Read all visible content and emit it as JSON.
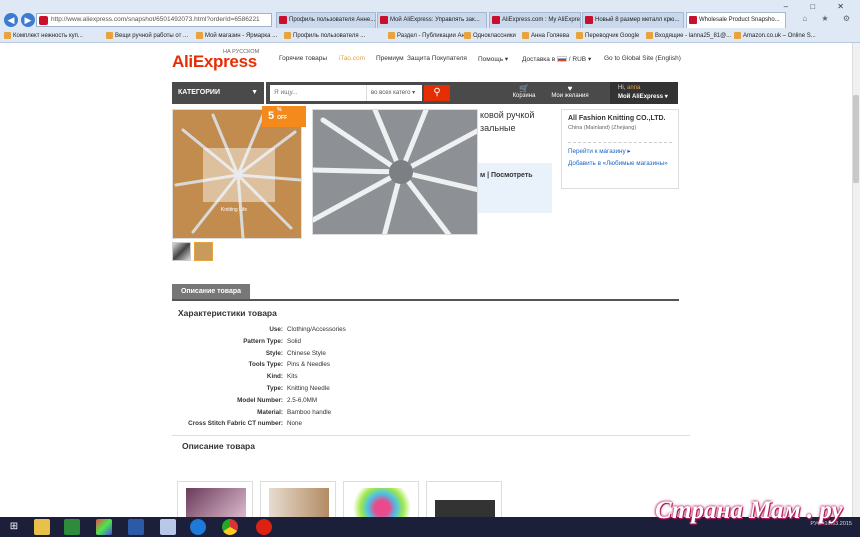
{
  "browser": {
    "address": "http://www.aliexpress.com/snapshot/6501492073.html?orderId=6586221",
    "tabs": [
      {
        "label": "Профиль пользователя Анне...",
        "active": false,
        "icon": "ali"
      },
      {
        "label": "Мой AliExpress: Управлять зак...",
        "active": false,
        "icon": "ali"
      },
      {
        "label": "AliExpress.com : My AliExpress",
        "active": false,
        "icon": "ali"
      },
      {
        "label": "Новый 8 размер металл крю...",
        "active": false,
        "icon": "ali"
      },
      {
        "label": "Wholesale Product Snapsho...",
        "active": true,
        "icon": "ali"
      }
    ],
    "bookmarks": [
      "Комплект нежность куп...",
      "Вещи ручной работы от ...",
      "Мой магазин - Ярмарка ...",
      "Профиль пользователя ...",
      "Раздел - Публикации Ан...",
      "Одноклассники",
      "Анна Голяева",
      "Переводчик Google",
      "Входящие - lanna25_81@...",
      "Amazon.co.uk – Online S..."
    ]
  },
  "site": {
    "logo": "AliExpress",
    "logo_sub": "НА РУССКОМ",
    "nav": {
      "hot": "Горячие товары",
      "itao": "iTao.com",
      "premium": "Премиум",
      "protection": "Защита Покупателя",
      "help": "Помощь",
      "delivery": "Доставка в",
      "currency": "RUB",
      "global": "Go to Global Site (English)"
    },
    "categories": "КАТЕГОРИИ",
    "search": {
      "placeholder": "Я ищу...",
      "category": "во всех катего"
    },
    "cart": "Корзина",
    "wishlist": "Мои желания",
    "account": {
      "greeting": "Hi,",
      "name": "anna",
      "label": "Мой AliExpress"
    }
  },
  "product": {
    "discount": "5",
    "discount_unit": "%",
    "discount_off": "OFF",
    "title_fragment": "ковой ручкой зальные",
    "view_store": "м | Посмотреть"
  },
  "seller": {
    "name": "All Fashion Knitting CO.,LTD.",
    "location": "China (Mainland) (Zhejiang)",
    "go_store": "Перейти к магазину",
    "add_fav": "Добавить в «Любимые магазины»"
  },
  "description_tab": "Описание товара",
  "specs_title": "Характеристики товара",
  "specs": [
    {
      "k": "Use:",
      "v": "Clothing/Accessories"
    },
    {
      "k": "Pattern Type:",
      "v": "Solid"
    },
    {
      "k": "Style:",
      "v": "Chinese Style"
    },
    {
      "k": "Tools Type:",
      "v": "Pins & Needles"
    },
    {
      "k": "Kind:",
      "v": "Kits"
    },
    {
      "k": "Type:",
      "v": "Knitting Needle"
    },
    {
      "k": "Model Number:",
      "v": "2.5-6.0MM"
    },
    {
      "k": "Material:",
      "v": "Bamboo handle"
    },
    {
      "k": "Cross Stitch Fabric CT number:",
      "v": "None"
    }
  ],
  "description_title": "Описание товара",
  "taskbar": {
    "lang": "РУС",
    "time": "16.03.2015"
  },
  "watermark": "Страна Мам . ру",
  "colors": {
    "accent": "#e62e04",
    "discount": "#f48a1b",
    "link": "#1a64c5",
    "dark": "#4a4a4a"
  }
}
